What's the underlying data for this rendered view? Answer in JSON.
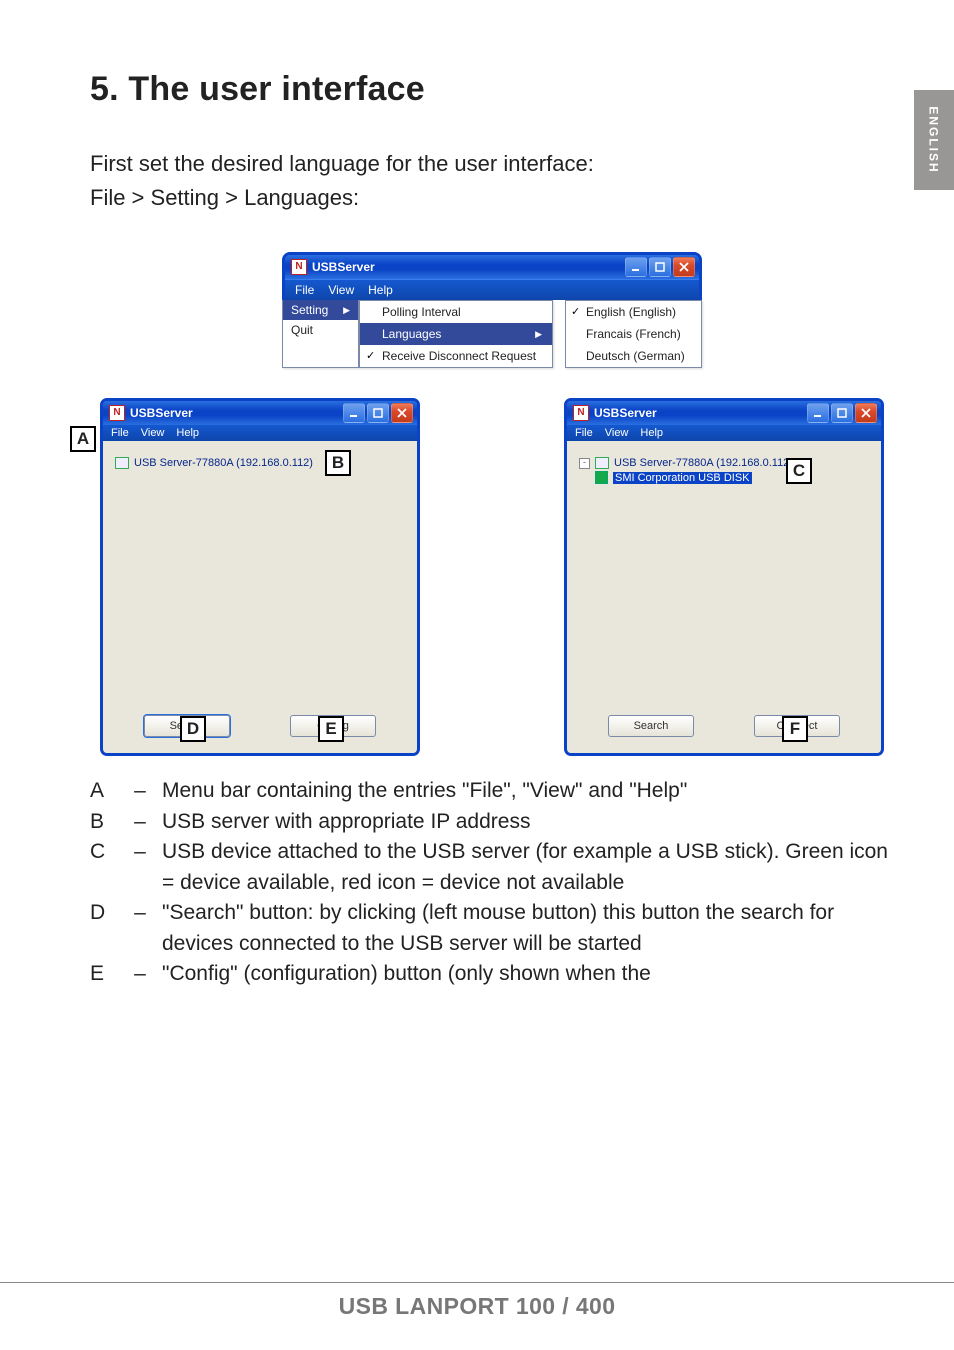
{
  "page": {
    "language_tab": "ENGLISH",
    "heading": "5. The user interface",
    "intro_line1": "First set the desired language for the user interface:",
    "intro_line2": "File > Setting > Languages:",
    "footer": "USB LANPORT 100 / 400"
  },
  "top_window": {
    "title": "USBServer",
    "menubar": {
      "file": "File",
      "view": "View",
      "help": "Help"
    },
    "file_menu": {
      "setting": "Setting",
      "quit": "Quit"
    },
    "setting_menu": {
      "polling": "Polling Interval",
      "languages": "Languages",
      "receive": "Receive Disconnect Request"
    },
    "lang_menu": {
      "english": "English (English)",
      "french": "Francais (French)",
      "german": "Deutsch (German)"
    }
  },
  "left_window": {
    "title": "USBServer",
    "menubar": {
      "file": "File",
      "view": "View",
      "help": "Help"
    },
    "server_label": "USB Server-77880A (192.168.0.112)",
    "buttons": {
      "search": "Search",
      "config": "Config"
    }
  },
  "right_window": {
    "title": "USBServer",
    "menubar": {
      "file": "File",
      "view": "View",
      "help": "Help"
    },
    "server_label": "USB Server-77880A (192.168.0.112)",
    "device_label": "SMI Corporation USB DISK",
    "buttons": {
      "search": "Search",
      "connect": "Connect"
    }
  },
  "callouts": {
    "A": "A",
    "B": "B",
    "C": "C",
    "D": "D",
    "E": "E",
    "F": "F"
  },
  "legend": {
    "A": "Menu bar containing the entries \"File\", \"View\" and \"Help\"",
    "B": "USB server with appropriate IP address",
    "C": "USB device attached to the USB server (for example a USB stick). Green icon = device available, red icon = device not available",
    "D": "\"Search\" button: by clicking (left mouse button) this button the search for devices connected to the USB server will be started",
    "E": "\"Config\" (configuration) button (only shown when the"
  }
}
